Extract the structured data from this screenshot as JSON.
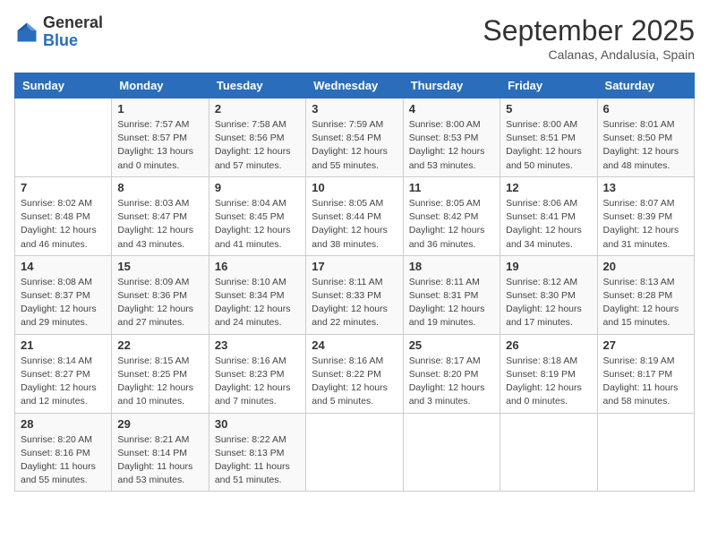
{
  "header": {
    "logo_general": "General",
    "logo_blue": "Blue",
    "month_title": "September 2025",
    "subtitle": "Calanas, Andalusia, Spain"
  },
  "days_of_week": [
    "Sunday",
    "Monday",
    "Tuesday",
    "Wednesday",
    "Thursday",
    "Friday",
    "Saturday"
  ],
  "weeks": [
    [
      {
        "day": "",
        "info": ""
      },
      {
        "day": "1",
        "info": "Sunrise: 7:57 AM\nSunset: 8:57 PM\nDaylight: 13 hours\nand 0 minutes."
      },
      {
        "day": "2",
        "info": "Sunrise: 7:58 AM\nSunset: 8:56 PM\nDaylight: 12 hours\nand 57 minutes."
      },
      {
        "day": "3",
        "info": "Sunrise: 7:59 AM\nSunset: 8:54 PM\nDaylight: 12 hours\nand 55 minutes."
      },
      {
        "day": "4",
        "info": "Sunrise: 8:00 AM\nSunset: 8:53 PM\nDaylight: 12 hours\nand 53 minutes."
      },
      {
        "day": "5",
        "info": "Sunrise: 8:00 AM\nSunset: 8:51 PM\nDaylight: 12 hours\nand 50 minutes."
      },
      {
        "day": "6",
        "info": "Sunrise: 8:01 AM\nSunset: 8:50 PM\nDaylight: 12 hours\nand 48 minutes."
      }
    ],
    [
      {
        "day": "7",
        "info": "Sunrise: 8:02 AM\nSunset: 8:48 PM\nDaylight: 12 hours\nand 46 minutes."
      },
      {
        "day": "8",
        "info": "Sunrise: 8:03 AM\nSunset: 8:47 PM\nDaylight: 12 hours\nand 43 minutes."
      },
      {
        "day": "9",
        "info": "Sunrise: 8:04 AM\nSunset: 8:45 PM\nDaylight: 12 hours\nand 41 minutes."
      },
      {
        "day": "10",
        "info": "Sunrise: 8:05 AM\nSunset: 8:44 PM\nDaylight: 12 hours\nand 38 minutes."
      },
      {
        "day": "11",
        "info": "Sunrise: 8:05 AM\nSunset: 8:42 PM\nDaylight: 12 hours\nand 36 minutes."
      },
      {
        "day": "12",
        "info": "Sunrise: 8:06 AM\nSunset: 8:41 PM\nDaylight: 12 hours\nand 34 minutes."
      },
      {
        "day": "13",
        "info": "Sunrise: 8:07 AM\nSunset: 8:39 PM\nDaylight: 12 hours\nand 31 minutes."
      }
    ],
    [
      {
        "day": "14",
        "info": "Sunrise: 8:08 AM\nSunset: 8:37 PM\nDaylight: 12 hours\nand 29 minutes."
      },
      {
        "day": "15",
        "info": "Sunrise: 8:09 AM\nSunset: 8:36 PM\nDaylight: 12 hours\nand 27 minutes."
      },
      {
        "day": "16",
        "info": "Sunrise: 8:10 AM\nSunset: 8:34 PM\nDaylight: 12 hours\nand 24 minutes."
      },
      {
        "day": "17",
        "info": "Sunrise: 8:11 AM\nSunset: 8:33 PM\nDaylight: 12 hours\nand 22 minutes."
      },
      {
        "day": "18",
        "info": "Sunrise: 8:11 AM\nSunset: 8:31 PM\nDaylight: 12 hours\nand 19 minutes."
      },
      {
        "day": "19",
        "info": "Sunrise: 8:12 AM\nSunset: 8:30 PM\nDaylight: 12 hours\nand 17 minutes."
      },
      {
        "day": "20",
        "info": "Sunrise: 8:13 AM\nSunset: 8:28 PM\nDaylight: 12 hours\nand 15 minutes."
      }
    ],
    [
      {
        "day": "21",
        "info": "Sunrise: 8:14 AM\nSunset: 8:27 PM\nDaylight: 12 hours\nand 12 minutes."
      },
      {
        "day": "22",
        "info": "Sunrise: 8:15 AM\nSunset: 8:25 PM\nDaylight: 12 hours\nand 10 minutes."
      },
      {
        "day": "23",
        "info": "Sunrise: 8:16 AM\nSunset: 8:23 PM\nDaylight: 12 hours\nand 7 minutes."
      },
      {
        "day": "24",
        "info": "Sunrise: 8:16 AM\nSunset: 8:22 PM\nDaylight: 12 hours\nand 5 minutes."
      },
      {
        "day": "25",
        "info": "Sunrise: 8:17 AM\nSunset: 8:20 PM\nDaylight: 12 hours\nand 3 minutes."
      },
      {
        "day": "26",
        "info": "Sunrise: 8:18 AM\nSunset: 8:19 PM\nDaylight: 12 hours\nand 0 minutes."
      },
      {
        "day": "27",
        "info": "Sunrise: 8:19 AM\nSunset: 8:17 PM\nDaylight: 11 hours\nand 58 minutes."
      }
    ],
    [
      {
        "day": "28",
        "info": "Sunrise: 8:20 AM\nSunset: 8:16 PM\nDaylight: 11 hours\nand 55 minutes."
      },
      {
        "day": "29",
        "info": "Sunrise: 8:21 AM\nSunset: 8:14 PM\nDaylight: 11 hours\nand 53 minutes."
      },
      {
        "day": "30",
        "info": "Sunrise: 8:22 AM\nSunset: 8:13 PM\nDaylight: 11 hours\nand 51 minutes."
      },
      {
        "day": "",
        "info": ""
      },
      {
        "day": "",
        "info": ""
      },
      {
        "day": "",
        "info": ""
      },
      {
        "day": "",
        "info": ""
      }
    ]
  ]
}
